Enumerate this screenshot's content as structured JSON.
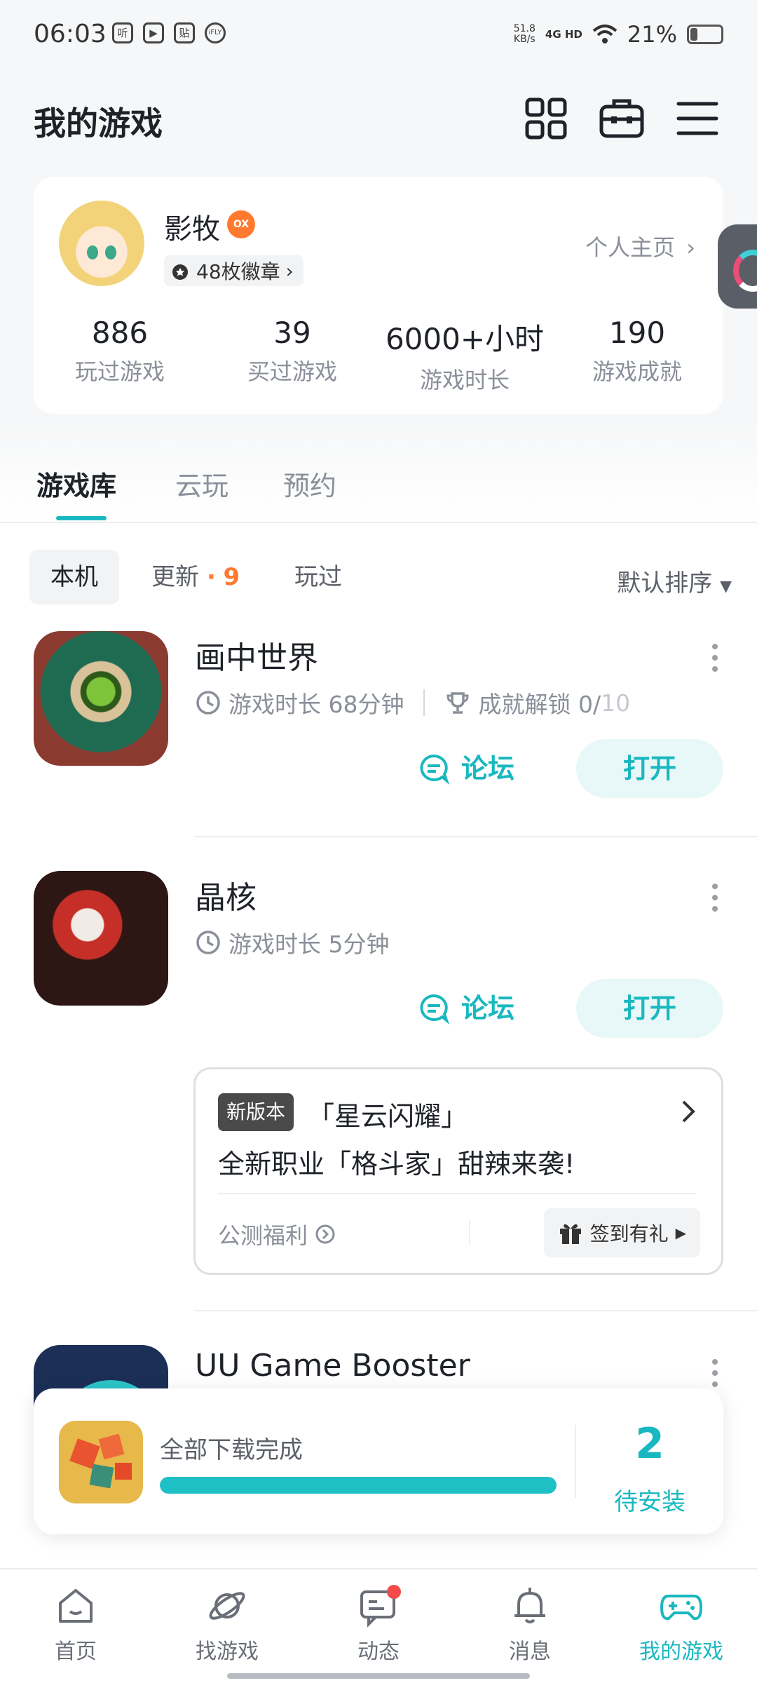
{
  "status_bar": {
    "time": "06:03",
    "notif_icons": [
      "听",
      "▶",
      "贴",
      "iFLY"
    ],
    "speed_value": "51.8",
    "speed_unit": "KB/s",
    "signal": "4G HD",
    "battery": "21%"
  },
  "header": {
    "title": "我的游戏"
  },
  "profile": {
    "name": "影牧",
    "badges": "48枚徽章",
    "homepage_link": "个人主页",
    "stats": [
      {
        "value": "886",
        "label": "玩过游戏"
      },
      {
        "value": "39",
        "label": "买过游戏"
      },
      {
        "value": "6000+小时",
        "label": "游戏时长"
      },
      {
        "value": "190",
        "label": "游戏成就"
      }
    ]
  },
  "tabs": [
    "游戏库",
    "云玩",
    "预约"
  ],
  "subtabs": {
    "local": "本机",
    "update": "更新",
    "update_dot": "·",
    "update_count": "9",
    "played": "玩过",
    "sort": "默认排序"
  },
  "games": [
    {
      "title": "画中世界",
      "playtime": "游戏时长 68分钟",
      "achievement_label": "成就解锁 0/",
      "achievement_total": "10",
      "forum": "论坛",
      "open": "打开"
    },
    {
      "title": "晶核",
      "playtime": "游戏时长 5分钟",
      "forum": "论坛",
      "open": "打开"
    },
    {
      "title": "UU Game Booster"
    }
  ],
  "news_card": {
    "badge": "新版本",
    "title": "「星云闪耀」",
    "subtitle": "全新职业「格斗家」甜辣来袭!",
    "welfare": "公测福利",
    "signin": "签到有礼"
  },
  "download_panel": {
    "status": "全部下载完成",
    "progress": 1.0,
    "count": "2",
    "count_label": "待安装"
  },
  "bottom_nav": [
    {
      "label": "首页",
      "icon": "home-icon"
    },
    {
      "label": "找游戏",
      "icon": "planet-icon"
    },
    {
      "label": "动态",
      "icon": "chat-icon"
    },
    {
      "label": "消息",
      "icon": "bell-icon"
    },
    {
      "label": "我的游戏",
      "icon": "gamepad-icon"
    }
  ],
  "colors": {
    "accent": "#19b8c0",
    "orange": "#ff7a2e",
    "text": "#1f2329",
    "muted": "#8a8f99"
  }
}
